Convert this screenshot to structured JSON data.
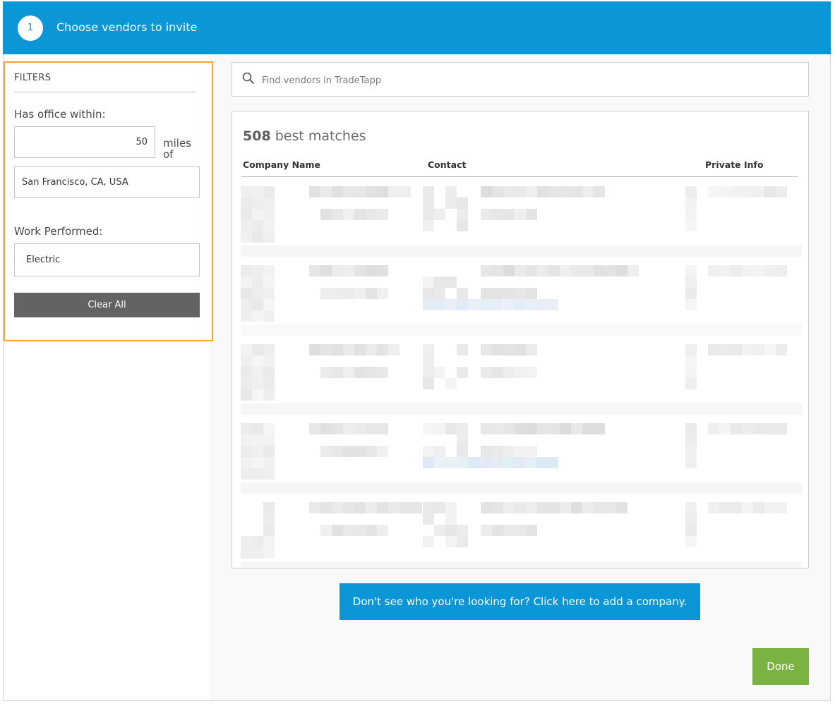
{
  "header": {
    "step_number": "1",
    "title": "Choose vendors to invite"
  },
  "filters": {
    "title": "FILTERS",
    "distance_label": "Has office within:",
    "distance_value": "50",
    "miles_label": "miles of",
    "location_value": "San Francisco, CA, USA",
    "work_label": "Work Performed:",
    "work_value": "Electric",
    "clear_label": "Clear All"
  },
  "search": {
    "placeholder": "Find vendors in TradeTapp"
  },
  "results": {
    "count": "508",
    "count_suffix": "best matches",
    "columns": [
      "Company Name",
      "Contact",
      "Private Info"
    ]
  },
  "actions": {
    "add_company_label": "Don't see who you're looking for? Click here to add a company.",
    "done_label": "Done"
  },
  "colors": {
    "header_blue": "#0a96d7",
    "filter_highlight": "#f5a33a",
    "done_green": "#7bb342",
    "clear_gray": "#636363"
  }
}
